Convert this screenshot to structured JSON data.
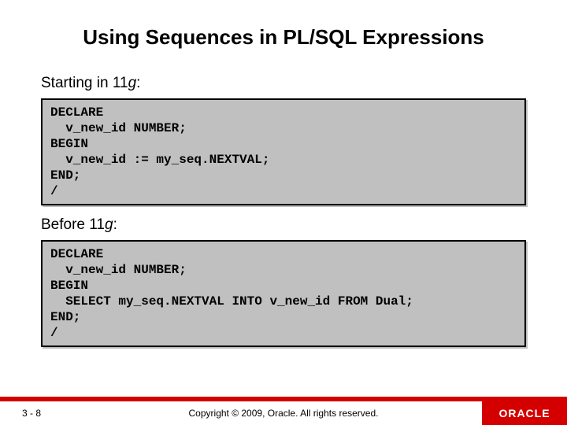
{
  "title": "Using Sequences in PL/SQL Expressions",
  "section1": {
    "prefix": "Starting in 11",
    "italic": "g",
    "suffix": ":"
  },
  "code1": "DECLARE\n  v_new_id NUMBER;\nBEGIN\n  v_new_id := my_seq.NEXTVAL;\nEND;\n/",
  "section2": {
    "prefix": "Before 11",
    "italic": "g",
    "suffix": ":"
  },
  "code2": "DECLARE\n  v_new_id NUMBER;\nBEGIN\n  SELECT my_seq.NEXTVAL INTO v_new_id FROM Dual;\nEND;\n/",
  "footer": {
    "page": "3 - 8",
    "copyright": "Copyright © 2009, Oracle. All rights reserved.",
    "logo": "ORACLE"
  }
}
